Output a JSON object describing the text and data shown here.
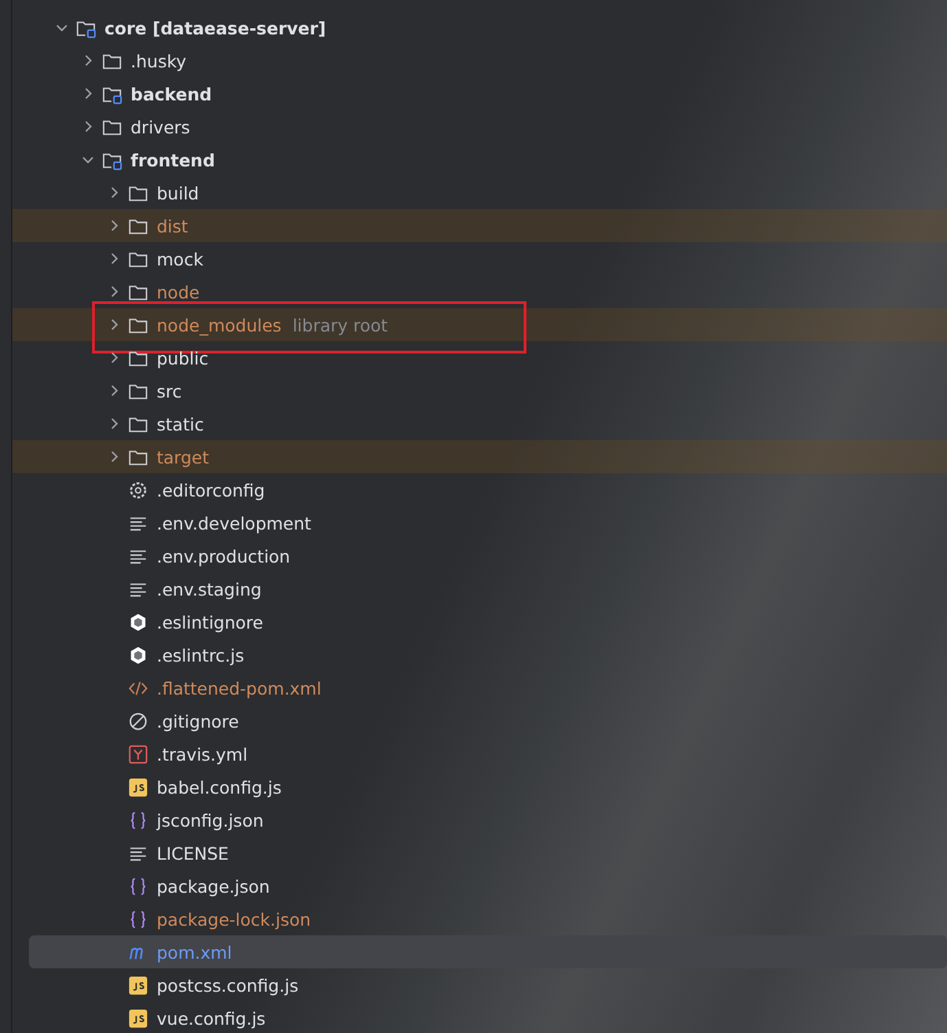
{
  "tree": [
    {
      "name": "core **[dataease-server]**",
      "kind": "module",
      "expanded": true,
      "excluded": false,
      "ignored": false,
      "modified": false,
      "children": [
        {
          "name": ".husky",
          "kind": "folder",
          "expanded": false,
          "excluded": false,
          "ignored": false,
          "modified": false
        },
        {
          "name": "backend",
          "kind": "module",
          "expanded": false,
          "excluded": false,
          "ignored": false,
          "modified": false
        },
        {
          "name": "drivers",
          "kind": "folder",
          "expanded": false,
          "excluded": false,
          "ignored": false,
          "modified": false
        },
        {
          "name": "frontend",
          "kind": "module",
          "expanded": true,
          "excluded": false,
          "ignored": false,
          "modified": false,
          "children": [
            {
              "name": "build",
              "kind": "folder",
              "expanded": false,
              "excluded": false,
              "ignored": false,
              "modified": false
            },
            {
              "name": "dist",
              "kind": "folder",
              "expanded": false,
              "excluded": true,
              "ignored": true,
              "modified": false
            },
            {
              "name": "mock",
              "kind": "folder",
              "expanded": false,
              "excluded": false,
              "ignored": false,
              "modified": false
            },
            {
              "name": "node",
              "kind": "folder",
              "expanded": false,
              "excluded": false,
              "ignored": true,
              "modified": false
            },
            {
              "name": "node_modules",
              "hint": "library root",
              "kind": "folder",
              "expanded": false,
              "excluded": true,
              "ignored": true,
              "modified": false,
              "highlighted": true
            },
            {
              "name": "public",
              "kind": "folder",
              "expanded": false,
              "excluded": false,
              "ignored": false,
              "modified": false
            },
            {
              "name": "src",
              "kind": "folder",
              "expanded": false,
              "excluded": false,
              "ignored": false,
              "modified": false
            },
            {
              "name": "static",
              "kind": "folder",
              "expanded": false,
              "excluded": false,
              "ignored": false,
              "modified": false
            },
            {
              "name": "target",
              "kind": "folder",
              "expanded": false,
              "excluded": true,
              "ignored": true,
              "modified": false
            },
            {
              "name": ".editorconfig",
              "kind": "settings",
              "excluded": false,
              "ignored": false,
              "modified": false
            },
            {
              "name": ".env.development",
              "kind": "text",
              "excluded": false,
              "ignored": false,
              "modified": false
            },
            {
              "name": ".env.production",
              "kind": "text",
              "excluded": false,
              "ignored": false,
              "modified": false
            },
            {
              "name": ".env.staging",
              "kind": "text",
              "excluded": false,
              "ignored": false,
              "modified": false
            },
            {
              "name": ".eslintignore",
              "kind": "eslint",
              "excluded": false,
              "ignored": false,
              "modified": false
            },
            {
              "name": ".eslintrc.js",
              "kind": "eslint",
              "excluded": false,
              "ignored": false,
              "modified": false
            },
            {
              "name": ".flattened-pom.xml",
              "kind": "xml",
              "excluded": false,
              "ignored": true,
              "modified": false
            },
            {
              "name": ".gitignore",
              "kind": "gitignore",
              "excluded": false,
              "ignored": false,
              "modified": false
            },
            {
              "name": ".travis.yml",
              "kind": "yaml",
              "excluded": false,
              "ignored": false,
              "modified": false
            },
            {
              "name": "babel.config.js",
              "kind": "js",
              "excluded": false,
              "ignored": false,
              "modified": false
            },
            {
              "name": "jsconfig.json",
              "kind": "json",
              "excluded": false,
              "ignored": false,
              "modified": false
            },
            {
              "name": "LICENSE",
              "kind": "text",
              "excluded": false,
              "ignored": false,
              "modified": false
            },
            {
              "name": "package.json",
              "kind": "json",
              "excluded": false,
              "ignored": false,
              "modified": false
            },
            {
              "name": "package-lock.json",
              "kind": "json",
              "excluded": false,
              "ignored": true,
              "modified": false
            },
            {
              "name": "pom.xml",
              "kind": "maven",
              "excluded": false,
              "ignored": false,
              "modified": true,
              "selected": true
            },
            {
              "name": "postcss.config.js",
              "kind": "js",
              "excluded": false,
              "ignored": false,
              "modified": false
            },
            {
              "name": "vue.config.js",
              "kind": "js",
              "excluded": false,
              "ignored": false,
              "modified": false
            }
          ]
        }
      ]
    }
  ]
}
